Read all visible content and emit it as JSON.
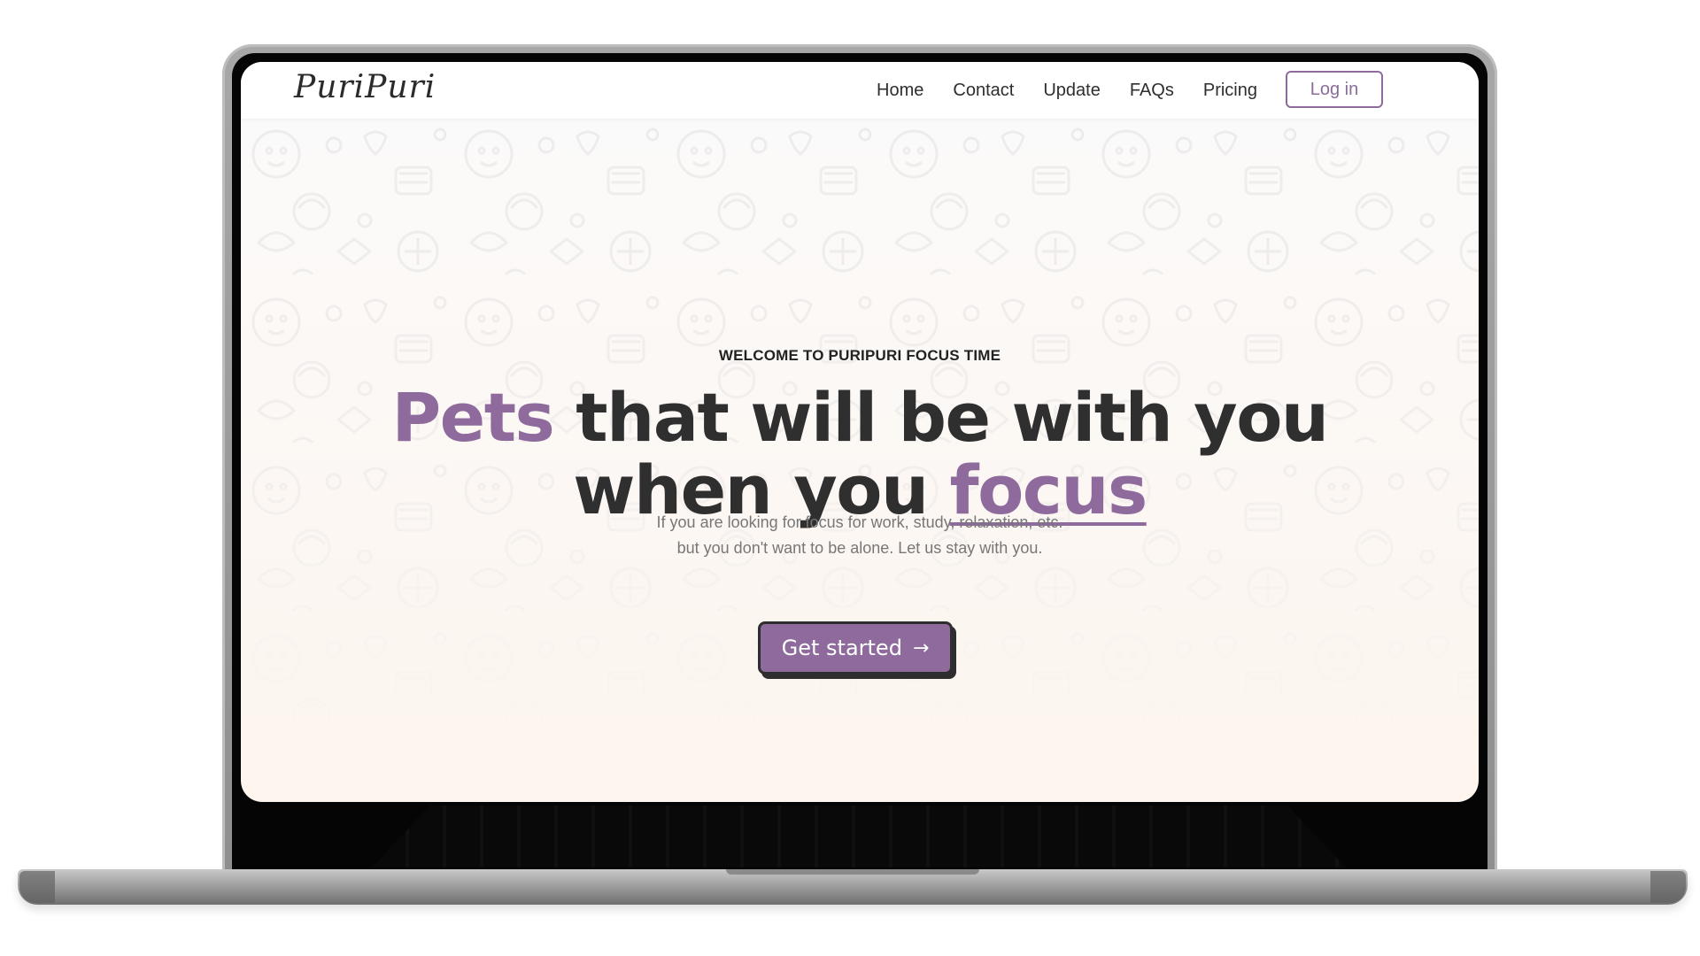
{
  "brand": {
    "logo_text": "PuriPuri"
  },
  "nav": {
    "items": [
      {
        "label": "Home"
      },
      {
        "label": "Contact"
      },
      {
        "label": "Update"
      },
      {
        "label": "FAQs"
      },
      {
        "label": "Pricing"
      }
    ],
    "login_label": "Log in"
  },
  "hero": {
    "eyebrow": "WELCOME TO PURIPURI FOCUS TIME",
    "headline_part1": "Pets",
    "headline_part2": " that will be with you",
    "headline_part3": "when you ",
    "headline_part4": "focus",
    "subtitle_line1": "If you are looking for focus for work, study, relaxation, etc.",
    "subtitle_line2": "but you don't want to be alone. Let us stay with you.",
    "cta_label": "Get started",
    "cta_icon": "arrow-right-icon"
  },
  "colors": {
    "accent": "#8e6b9c",
    "text_dark": "#2f2f2f",
    "text_muted": "#777777",
    "background": "#fdf6ef"
  }
}
